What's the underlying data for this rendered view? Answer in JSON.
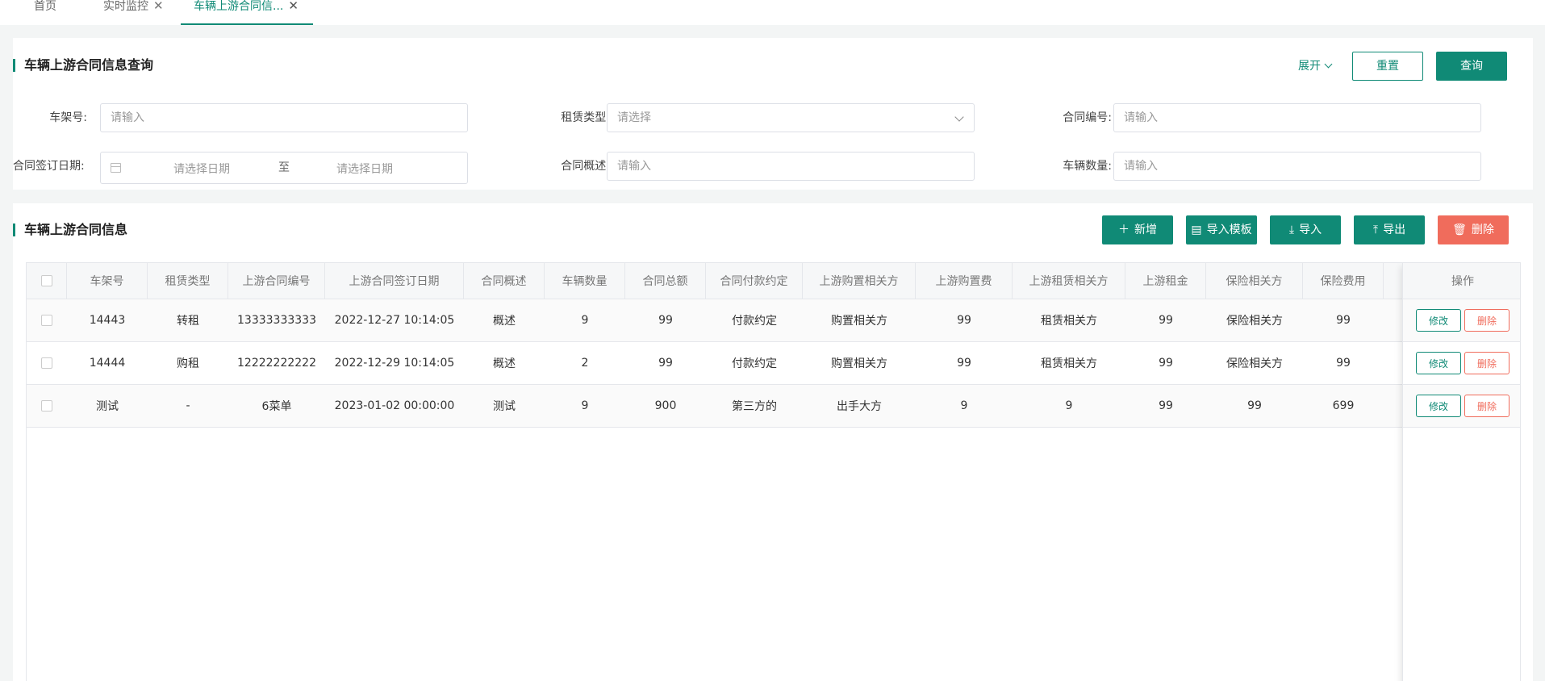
{
  "tabs": [
    {
      "label": "首页"
    },
    {
      "label": "实时监控"
    },
    {
      "label": "车辆上游合同信..."
    }
  ],
  "search": {
    "title": "车辆上游合同信息查询",
    "expand_label": "展开",
    "reset_label": "重置",
    "query_label": "查询",
    "fields": {
      "vin_label": "车架号:",
      "vin_placeholder": "请输入",
      "lease_type_label": "租赁类型:",
      "lease_type_placeholder": "请选择",
      "contract_no_label": "合同编号:",
      "contract_no_placeholder": "请输入",
      "sign_date_label": "合同签订日期:",
      "date_start_placeholder": "请选择日期",
      "date_sep": "至",
      "date_end_placeholder": "请选择日期",
      "summary_label": "合同概述:",
      "summary_placeholder": "请输入",
      "vehicle_count_label": "车辆数量:",
      "vehicle_count_placeholder": "请输入"
    }
  },
  "table_section": {
    "title": "车辆上游合同信息",
    "add_label": "新增",
    "import_template_label": "导入模板",
    "import_label": "导入",
    "export_label": "导出",
    "delete_label": "删除"
  },
  "table": {
    "headers": [
      "车架号",
      "租赁类型",
      "上游合同编号",
      "上游合同签订日期",
      "合同概述",
      "车辆数量",
      "合同总额",
      "合同付款约定",
      "上游购置相关方",
      "上游购置费",
      "上游租赁相关方",
      "上游租金",
      "保险相关方",
      "保险费用"
    ],
    "action_header": "操作",
    "edit_label": "修改",
    "delete_label": "删除",
    "rows": [
      [
        "14443",
        "转租",
        "13333333333",
        "2022-12-27 10:14:05",
        "概述",
        "9",
        "99",
        "付款约定",
        "购置相关方",
        "99",
        "租赁相关方",
        "99",
        "保险相关方",
        "99"
      ],
      [
        "14444",
        "购租",
        "12222222222",
        "2022-12-29 10:14:05",
        "概述",
        "2",
        "99",
        "付款约定",
        "购置相关方",
        "99",
        "租赁相关方",
        "99",
        "保险相关方",
        "99"
      ],
      [
        "测试",
        "-",
        "6菜单",
        "2023-01-02 00:00:00",
        "测试",
        "9",
        "900",
        "第三方的",
        "出手大方",
        "9",
        "9",
        "99",
        "99",
        "699"
      ]
    ]
  },
  "colors": {
    "primary": "#108a76",
    "danger": "#f06c5c"
  }
}
